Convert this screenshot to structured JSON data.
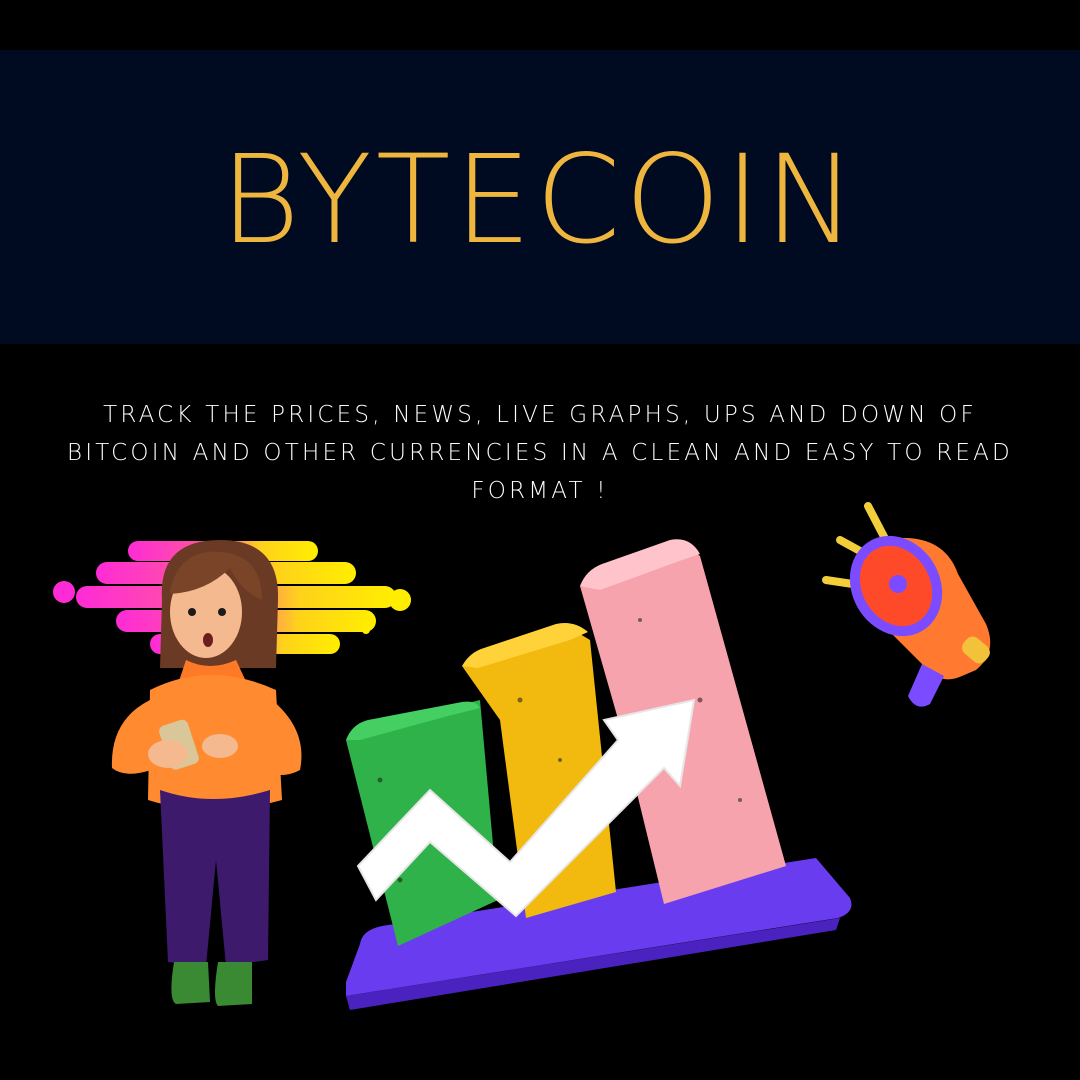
{
  "header": {
    "title": "BYTECOIN",
    "background_color": "#000a20",
    "title_color": "#efb63f"
  },
  "tagline": {
    "text": "TRACK THE PRICES, NEWS, LIVE GRAPHS, UPS AND DOWN OF BITCOIN AND OTHER CURRENCIES IN A CLEAN AND EASY TO READ FORMAT !"
  },
  "illustrations": [
    {
      "name": "woman-with-phone-illustration"
    },
    {
      "name": "bar-chart-with-arrow-illustration"
    },
    {
      "name": "megaphone-icon"
    }
  ]
}
